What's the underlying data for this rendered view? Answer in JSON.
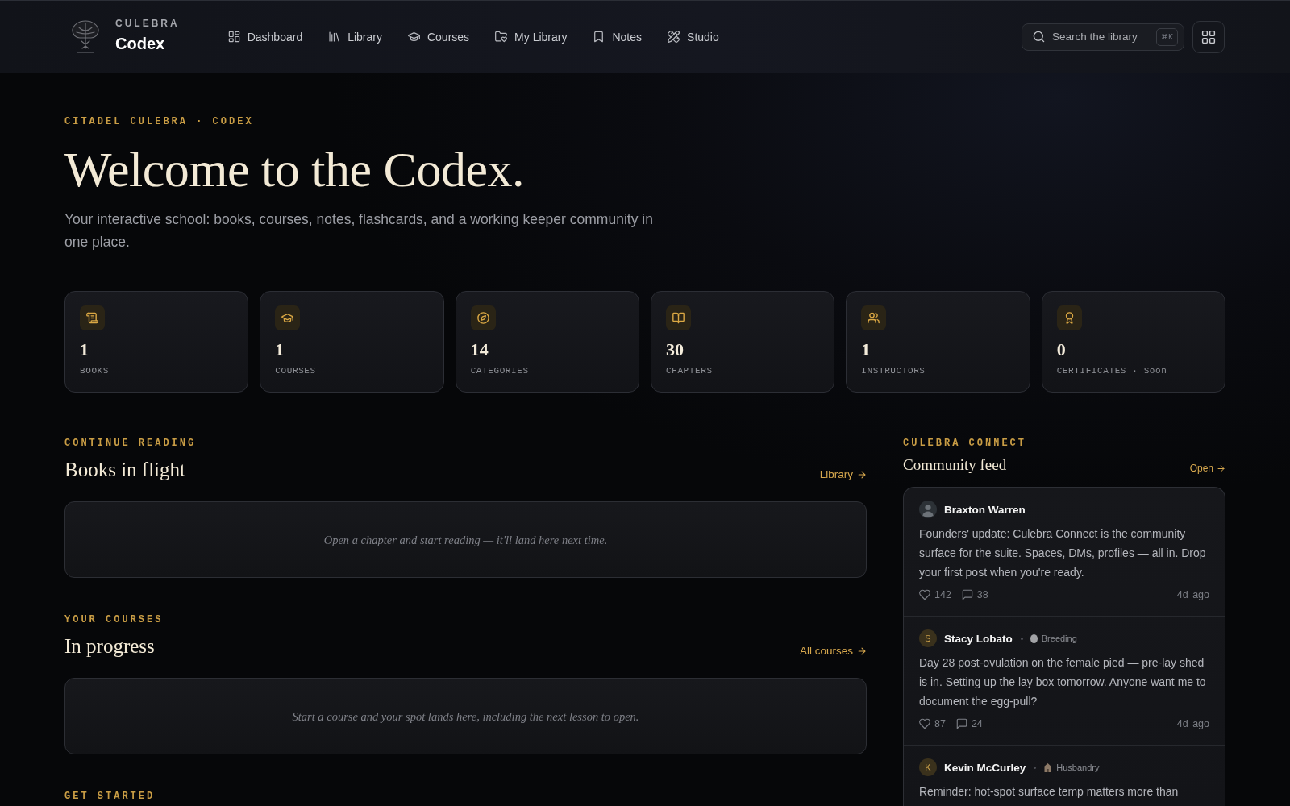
{
  "header": {
    "brand": {
      "eyebrow": "CULEBRA",
      "name": "Codex"
    },
    "nav": [
      {
        "label": "Dashboard"
      },
      {
        "label": "Library"
      },
      {
        "label": "Courses"
      },
      {
        "label": "My Library"
      },
      {
        "label": "Notes"
      },
      {
        "label": "Studio"
      }
    ],
    "search": {
      "placeholder": "Search the library",
      "shortcut": "⌘K"
    }
  },
  "hero": {
    "eyebrow": "CITADEL CULEBRA · CODEX",
    "title": "Welcome to the Codex.",
    "subtitle": "Your interactive school: books, courses, notes, flashcards, and a working keeper community in one place."
  },
  "stats": [
    {
      "value": "1",
      "label": "BOOKS"
    },
    {
      "value": "1",
      "label": "COURSES"
    },
    {
      "value": "14",
      "label": "CATEGORIES"
    },
    {
      "value": "30",
      "label": "CHAPTERS"
    },
    {
      "value": "1",
      "label": "INSTRUCTORS"
    },
    {
      "value": "0",
      "label": "CERTIFICATES · Soon"
    }
  ],
  "sections": [
    {
      "eyebrow": "CONTINUE READING",
      "title": "Books in flight",
      "link": "Library",
      "empty_text": "Open a chapter and start reading — it'll land here next time."
    },
    {
      "eyebrow": "YOUR COURSES",
      "title": "In progress",
      "link": "All courses",
      "empty_text": "Start a course and your spot lands here, including the next lesson to open."
    },
    {
      "eyebrow": "GET STARTED"
    }
  ],
  "feed": {
    "eyebrow": "CULEBRA CONNECT",
    "title": "Community feed",
    "link": "Open",
    "posts": [
      {
        "author": "Braxton Warren",
        "body": "Founders' update: Culebra Connect is the community surface for the suite. Spaces, DMs, profiles — all in. Drop your first post when you're ready.",
        "likes": "142",
        "comments": "38",
        "time": "4d ago"
      },
      {
        "author": "Stacy Lobato",
        "initial": "S",
        "tag": "Breeding",
        "body": "Day 28 post-ovulation on the female pied — pre-lay shed is in. Setting up the lay box tomorrow. Anyone want me to document the egg-pull?",
        "likes": "87",
        "comments": "24",
        "time": "4d ago"
      },
      {
        "author": "Kevin McCurley",
        "initial": "K",
        "tag": "Husbandry",
        "body": "Reminder: hot-spot surface temp matters more than"
      }
    ]
  }
}
